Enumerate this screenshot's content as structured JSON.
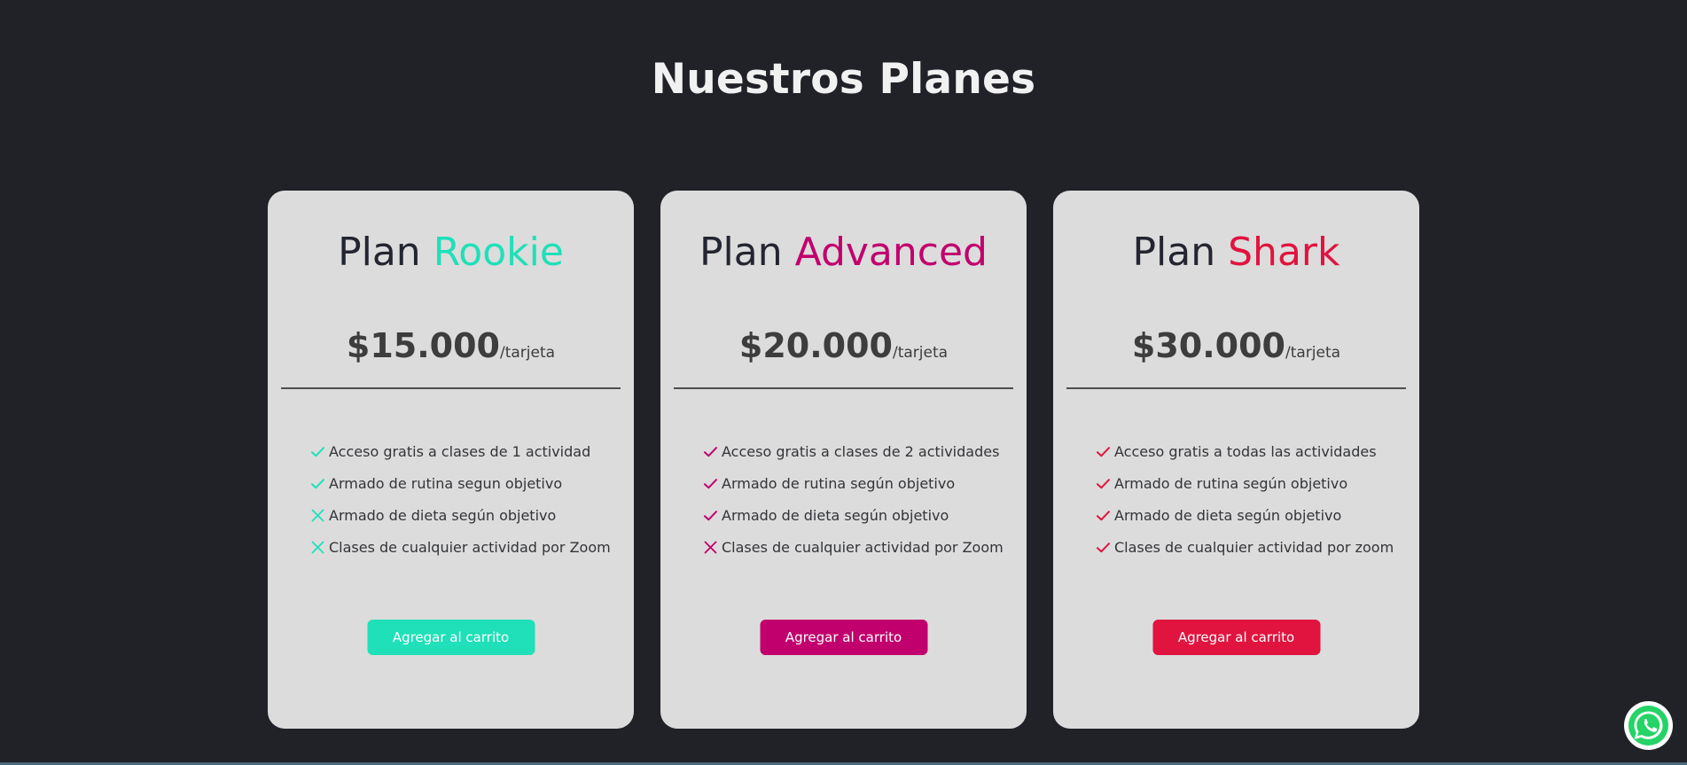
{
  "section": {
    "title": "Nuestros Planes"
  },
  "colors": {
    "background": "#212228",
    "card": "#dcdcdc",
    "rookie": "#1fe0b8",
    "advanced": "#c2006d",
    "shark": "#e0143e",
    "whatsapp": "#25d366"
  },
  "plans": [
    {
      "prefix": "Plan",
      "name": "Rookie",
      "accent": "#1fe0b8",
      "price": "$15.000",
      "per": "/tarjeta",
      "button_label": "Agregar al carrito",
      "features": [
        {
          "text": "Acceso gratis a clases de 1 actividad",
          "included": true,
          "icon": "check-icon"
        },
        {
          "text": "Armado de rutina segun objetivo",
          "included": true,
          "icon": "check-icon"
        },
        {
          "text": "Armado de dieta según objetivo",
          "included": false,
          "icon": "cross-icon"
        },
        {
          "text": "Clases de cualquier actividad por Zoom",
          "included": false,
          "icon": "cross-icon"
        }
      ]
    },
    {
      "prefix": "Plan",
      "name": "Advanced",
      "accent": "#c2006d",
      "price": "$20.000",
      "per": "/tarjeta",
      "button_label": "Agregar al carrito",
      "features": [
        {
          "text": "Acceso gratis a clases de 2 actividades",
          "included": true,
          "icon": "check-icon"
        },
        {
          "text": "Armado de rutina según objetivo",
          "included": true,
          "icon": "check-icon"
        },
        {
          "text": "Armado de dieta según objetivo",
          "included": true,
          "icon": "check-icon"
        },
        {
          "text": "Clases de cualquier actividad por Zoom",
          "included": false,
          "icon": "cross-icon"
        }
      ]
    },
    {
      "prefix": "Plan",
      "name": "Shark",
      "accent": "#e0143e",
      "price": "$30.000",
      "per": "/tarjeta",
      "button_label": "Agregar al carrito",
      "features": [
        {
          "text": "Acceso gratis a todas las actividades",
          "included": true,
          "icon": "check-icon"
        },
        {
          "text": "Armado de rutina según objetivo",
          "included": true,
          "icon": "check-icon"
        },
        {
          "text": "Armado de dieta según objetivo",
          "included": true,
          "icon": "check-icon"
        },
        {
          "text": "Clases de cualquier actividad por zoom",
          "included": true,
          "icon": "check-icon"
        }
      ]
    }
  ],
  "floating": {
    "icon": "whatsapp-icon"
  }
}
